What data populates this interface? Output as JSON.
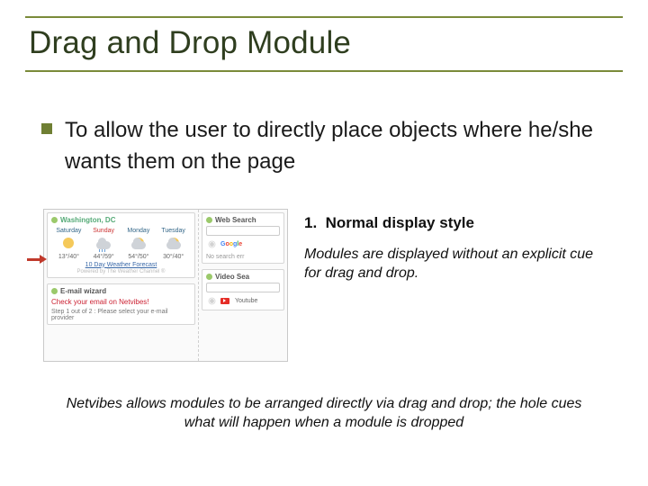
{
  "title": "Drag and Drop Module",
  "bullet": "To allow the user to directly place objects where he/she wants them on the page",
  "step": {
    "num": "1.",
    "title": "Normal display style",
    "desc": "Modules are displayed without an explicit cue for drag and drop."
  },
  "caption": "Netvibes allows modules to be arranged directly via drag and drop; the hole cues what will happen when a module is dropped",
  "shot": {
    "weather": {
      "header": "Washington, DC",
      "days": [
        {
          "name": "Saturday",
          "icon": "sun",
          "temps": "13°/40°"
        },
        {
          "name": "Sunday",
          "icon": "rain",
          "temps": "44°/59°"
        },
        {
          "name": "Monday",
          "icon": "cloud",
          "temps": "54°/50°"
        },
        {
          "name": "Tuesday",
          "icon": "cloud",
          "temps": "30°/40°"
        }
      ],
      "forecast_link": "10 Day Weather Forecast",
      "powered": "Powered by The Weather Channel ®"
    },
    "wizard": {
      "header": "E-mail wizard",
      "line1": "Check your email on Netvibes!",
      "line2": "Step 1 out of 2 : Please select your e-mail provider"
    },
    "search": {
      "header": "Web Search",
      "engine": "Google",
      "noerr": "No search err"
    },
    "video": {
      "header": "Video Sea",
      "yt": "Youtube"
    }
  }
}
